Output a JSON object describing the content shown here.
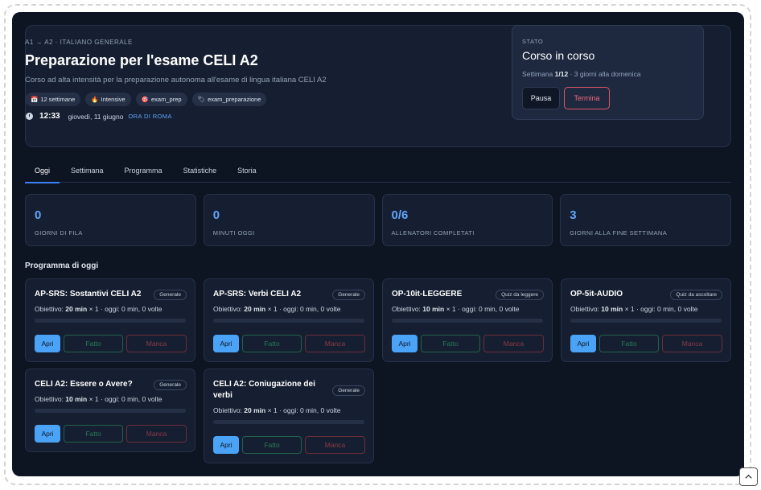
{
  "hero": {
    "eyebrow": "A1 → A2 · ITALIANO GENERALE",
    "title": "Preparazione per l'esame CELI A2",
    "subtitle": "Corso ad alta intensità per la preparazione autonoma all'esame di lingua italiana CELI A2",
    "tags": [
      {
        "icon": "📅",
        "icon_name": "calendar-icon",
        "label": "12 settimane"
      },
      {
        "icon": "🔥",
        "icon_name": "fire-icon",
        "label": "Intensive"
      },
      {
        "icon": "🎯",
        "icon_name": "target-icon",
        "label": "exam_prep"
      },
      {
        "icon": "🏷",
        "icon_name": "tag-icon",
        "label": "exam_preparazione"
      }
    ],
    "time": "12:33",
    "date": "giovedì, 11 giugno",
    "timezone": "ORA DI ROMA"
  },
  "status": {
    "label": "STATO",
    "title": "Corso in corso",
    "week_prefix": "Settimana ",
    "week_value": "1/12",
    "week_suffix": " · 3 giorni alla domenica",
    "pause_label": "Pausa",
    "stop_label": "Termina"
  },
  "tabs": [
    {
      "label": "Oggi",
      "active": true
    },
    {
      "label": "Settimana",
      "active": false
    },
    {
      "label": "Programma",
      "active": false
    },
    {
      "label": "Statistiche",
      "active": false
    },
    {
      "label": "Storia",
      "active": false
    }
  ],
  "stats": [
    {
      "value": "0",
      "label": "GIORNI DI FILA"
    },
    {
      "value": "0",
      "label": "MINUTI OGGI"
    },
    {
      "value": "0/6",
      "label": "ALLENATORI COMPLETATI"
    },
    {
      "value": "3",
      "label": "GIORNI ALLA FINE SETTIMANA"
    }
  ],
  "section_title": "Programma di oggi",
  "cards": [
    {
      "title": "AP-SRS: Sostantivi CELI A2",
      "badge": "Generale",
      "goal_prefix": "Obiettivo: ",
      "goal_bold": "20 min",
      "goal_suffix": " × 1 · oggi: 0 min, 0 volte",
      "progress": 0,
      "open": "Apri",
      "done": "Fatto",
      "miss": "Manca"
    },
    {
      "title": "AP-SRS: Verbi CELI A2",
      "badge": "Generale",
      "goal_prefix": "Obiettivo: ",
      "goal_bold": "20 min",
      "goal_suffix": " × 1 · oggi: 0 min, 0 volte",
      "progress": 0,
      "open": "Apri",
      "done": "Fatto",
      "miss": "Manca"
    },
    {
      "title": "OP-10it-LEGGERE",
      "badge": "Quiz da leggere",
      "goal_prefix": "Obiettivo: ",
      "goal_bold": "10 min",
      "goal_suffix": " × 1 · oggi: 0 min, 0 volte",
      "progress": 0,
      "open": "Apri",
      "done": "Fatto",
      "miss": "Manca"
    },
    {
      "title": "OP-5it-AUDIO",
      "badge": "Quiz da ascoltare",
      "goal_prefix": "Obiettivo: ",
      "goal_bold": "10 min",
      "goal_suffix": " × 1 · oggi: 0 min, 0 volte",
      "progress": 0,
      "open": "Apri",
      "done": "Fatto",
      "miss": "Manca"
    },
    {
      "title": "CELI A2: Essere o Avere?",
      "badge": "Generale",
      "goal_prefix": "Obiettivo: ",
      "goal_bold": "10 min",
      "goal_suffix": " × 1 · oggi: 0 min, 0 volte",
      "progress": 0,
      "open": "Apri",
      "done": "Fatto",
      "miss": "Manca"
    },
    {
      "title": "CELI A2: Coniugazione dei verbi",
      "badge": "Generale",
      "goal_prefix": "Obiettivo: ",
      "goal_bold": "20 min",
      "goal_suffix": " × 1 · oggi: 0 min, 0 volte",
      "progress": 0,
      "open": "Apri",
      "done": "Fatto",
      "miss": "Manca"
    }
  ],
  "scroll_top_icon": "chevron-up-icon"
}
